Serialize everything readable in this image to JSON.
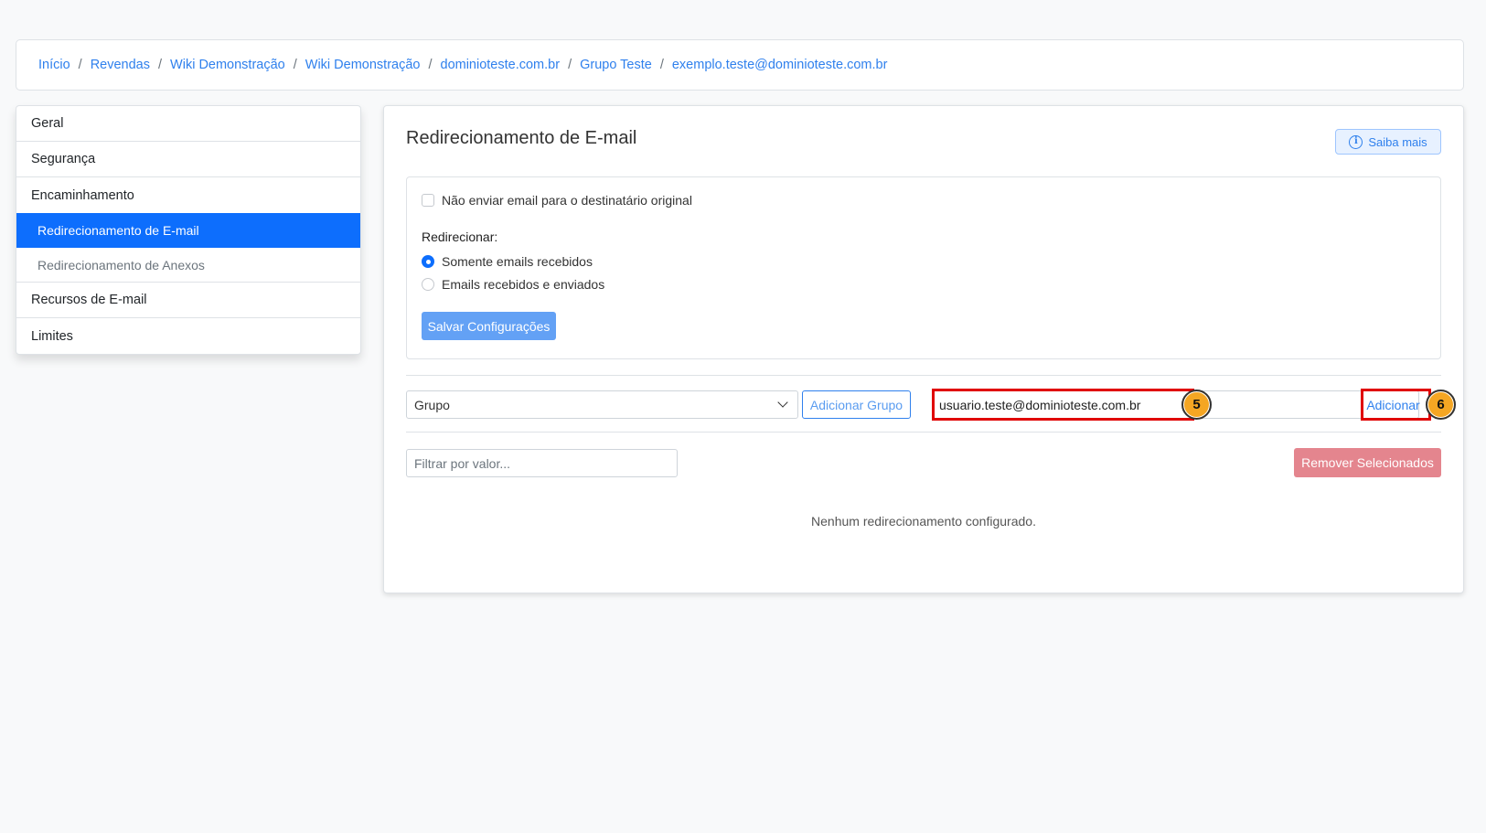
{
  "breadcrumb": [
    {
      "label": "Início"
    },
    {
      "label": "Revendas"
    },
    {
      "label": "Wiki Demonstração"
    },
    {
      "label": "Wiki Demonstração"
    },
    {
      "label": "dominioteste.com.br"
    },
    {
      "label": "Grupo Teste"
    },
    {
      "label": "exemplo.teste@dominioteste.com.br"
    }
  ],
  "breadcrumb_separator": "/",
  "sidebar": {
    "geral": "Geral",
    "seguranca": "Segurança",
    "encaminhamento": "Encaminhamento",
    "redirecionamento_email": "Redirecionamento de E-mail",
    "redirecionamento_anexos": "Redirecionamento de Anexos",
    "recursos_email": "Recursos de E-mail",
    "limites": "Limites",
    "active_item": "Redirecionamento de E-mail"
  },
  "main": {
    "title": "Redirecionamento de E-mail",
    "saiba_mais": "Saiba mais",
    "info_icon_glyph": "i",
    "settings": {
      "no_send_label": "Não enviar email para o destinatário original",
      "no_send_checked": false,
      "redirect_label": "Redirecionar:",
      "option_received": "Somente emails recebidos",
      "option_both": "Emails recebidos e enviados",
      "selected_option": "Somente emails recebidos",
      "save_button": "Salvar Configurações"
    },
    "add_row": {
      "group_select_value": "Grupo",
      "add_group_button": "Adicionar Grupo",
      "email_value": "usuario.teste@dominioteste.com.br",
      "add_button": "Adicionar",
      "step_email": "5",
      "step_add": "6"
    },
    "filter_placeholder": "Filtrar por valor...",
    "remove_selected_button": "Remover Selecionados",
    "empty_message": "Nenhum redirecionamento configurado."
  },
  "colors": {
    "primary": "#0d6efd",
    "link": "#2f80ed",
    "danger_light": "#e4858e",
    "highlight": "#e00000",
    "step_badge": "#f5a623"
  }
}
